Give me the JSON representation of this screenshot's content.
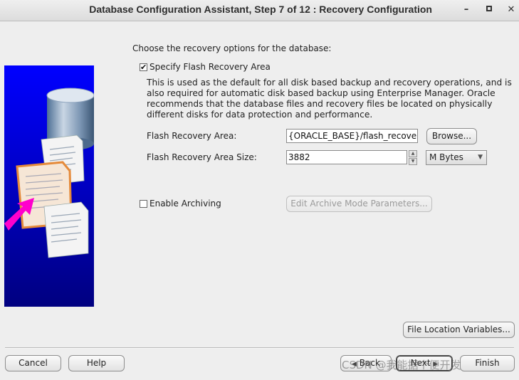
{
  "window": {
    "title": "Database Configuration Assistant, Step 7 of 12 : Recovery Configuration",
    "minimize_glyph": "–",
    "close_glyph": "✕"
  },
  "main": {
    "intro": "Choose the recovery options for the database:",
    "flash": {
      "checkbox_label": "Specify Flash Recovery Area",
      "checked": true,
      "check_glyph": "✔",
      "description": "This is used as the default for all disk based backup and recovery operations, and is also required for automatic disk based backup using Enterprise Manager. Oracle recommends that the database files and recovery files be located on physically different disks for data protection and performance.",
      "area_label": "Flash Recovery Area:",
      "area_value": "{ORACLE_BASE}/flash_recovery_",
      "browse_label": "Browse...",
      "size_label": "Flash Recovery Area Size:",
      "size_value": "3882",
      "unit_value": "M Bytes"
    },
    "archiving": {
      "checkbox_label": "Enable Archiving",
      "checked": false,
      "edit_params_label": "Edit Archive Mode Parameters..."
    },
    "file_location_label": "File Location Variables..."
  },
  "footer": {
    "cancel_label": "Cancel",
    "help_label": "Help",
    "back_label": "Back",
    "next_label": "Next",
    "finish_label": "Finish",
    "back_glyph": "◀",
    "next_glyph": "▶"
  },
  "watermark": "CSDN @我能据个便开发",
  "icons": [
    "database-cylinder-icon",
    "document-stack-icon",
    "magenta-arrow-icon",
    "spin-up-icon",
    "spin-down-icon",
    "dropdown-arrow-icon"
  ],
  "colors": {
    "illustration_top": "#0000ff",
    "illustration_bottom": "#000080",
    "arrow": "#ff00cc",
    "window_bg": "#eeeeee"
  }
}
